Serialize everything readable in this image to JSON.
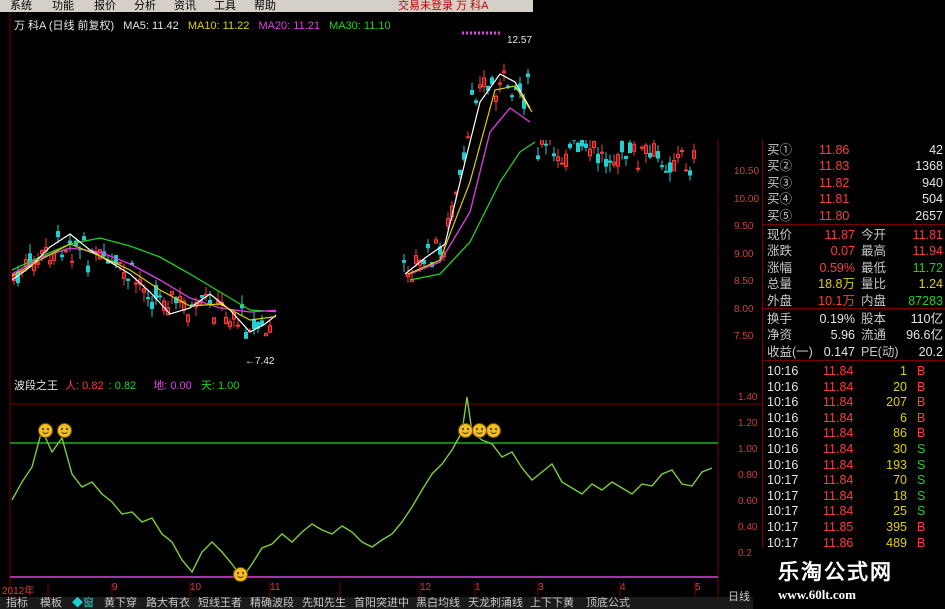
{
  "menu": [
    "系统",
    "功能",
    "报价",
    "分析",
    "资讯",
    "工具",
    "帮助"
  ],
  "menu_right": "交易未登录  万  科A",
  "chart_header": {
    "stock": "万  科A (日线 前复权)",
    "ma5": "MA5: 11.42",
    "ma10": "MA10: 11.22",
    "ma20": "MA20: 11.21",
    "ma30": "MA30: 11.10"
  },
  "price_axis": [
    "10.50",
    "10.00",
    "9.50",
    "9.00",
    "8.50",
    "8.00",
    "7.50"
  ],
  "price_marks": {
    "high": "12.57",
    "low": "←7.42"
  },
  "indicator": {
    "name": "波段之王",
    "ren": "人: 0.82",
    "ren_val": ": 0.82",
    "di": "地: 0.00",
    "tian": "天: 1.00"
  },
  "indicator_axis": [
    "1.40",
    "1.20",
    "1.00",
    "0.80",
    "0.60",
    "0.40",
    "0.2"
  ],
  "x_axis": [
    "2012年",
    "9",
    "10",
    "11",
    "12",
    "1",
    "3",
    "4",
    "5"
  ],
  "order_book": [
    {
      "label": "买①",
      "price": "11.86",
      "vol": "42"
    },
    {
      "label": "买②",
      "price": "11.83",
      "vol": "1368"
    },
    {
      "label": "买③",
      "price": "11.82",
      "vol": "940"
    },
    {
      "label": "买④",
      "price": "11.81",
      "vol": "504"
    },
    {
      "label": "买⑤",
      "price": "11.80",
      "vol": "2657"
    }
  ],
  "quote": [
    {
      "l1": "现价",
      "v1": "11.87",
      "l2": "今开",
      "v2": "11.81"
    },
    {
      "l1": "涨跌",
      "v1": "0.07",
      "l2": "最高",
      "v2": "11.94"
    },
    {
      "l1": "涨幅",
      "v1": "0.59%",
      "l2": "最低",
      "v2": "11.72"
    },
    {
      "l1": "总量",
      "v1": "18.8万",
      "l2": "量比",
      "v2": "1.24"
    },
    {
      "l1": "外盘",
      "v1": "10.1万",
      "l2": "内盘",
      "v2": "87283"
    }
  ],
  "stats": [
    {
      "l1": "换手",
      "v1": "0.19%",
      "l2": "股本",
      "v2": "110亿"
    },
    {
      "l1": "净资",
      "v1": "5.96",
      "l2": "流通",
      "v2": "96.6亿"
    },
    {
      "l1": "收益(一)",
      "v1": "0.147",
      "l2": "PE(动)",
      "v2": "20.2"
    }
  ],
  "trades": [
    {
      "time": "10:16",
      "price": "11.84",
      "vol": "1",
      "side": "B"
    },
    {
      "time": "10:16",
      "price": "11.84",
      "vol": "20",
      "side": "B"
    },
    {
      "time": "10:16",
      "price": "11.84",
      "vol": "207",
      "side": "B"
    },
    {
      "time": "10:16",
      "price": "11.84",
      "vol": "6",
      "side": "B"
    },
    {
      "time": "10:16",
      "price": "11.84",
      "vol": "86",
      "side": "B"
    },
    {
      "time": "10:16",
      "price": "11.84",
      "vol": "30",
      "side": "S"
    },
    {
      "time": "10:16",
      "price": "11.84",
      "vol": "193",
      "side": "S"
    },
    {
      "time": "10:17",
      "price": "11.84",
      "vol": "70",
      "side": "S"
    },
    {
      "time": "10:17",
      "price": "11.84",
      "vol": "18",
      "side": "S"
    },
    {
      "time": "10:17",
      "price": "11.84",
      "vol": "25",
      "side": "S"
    },
    {
      "time": "10:17",
      "price": "11.85",
      "vol": "395",
      "side": "B"
    },
    {
      "time": "10:17",
      "price": "11.86",
      "vol": "489",
      "side": "B"
    }
  ],
  "tabs": [
    "指标",
    "模板",
    "◆窗",
    "黄下穿",
    "路大有衣",
    "短线王者",
    "精确波段",
    "先知先生",
    "首阳突进中",
    "黑白均线",
    "天龙刺涌线",
    "上下下黄",
    "顶底公式"
  ],
  "day_button": "日线",
  "watermark": {
    "title": "乐淘公式网",
    "url": "www.60lt.com"
  },
  "colors": {
    "up": "#ff3b3b",
    "down": "#20d0d0",
    "indicator": "#7ccf3a",
    "ma5": "#ffffff",
    "ma10": "#e0d000",
    "ma20": "#e040e0",
    "ma30": "#20d020"
  }
}
